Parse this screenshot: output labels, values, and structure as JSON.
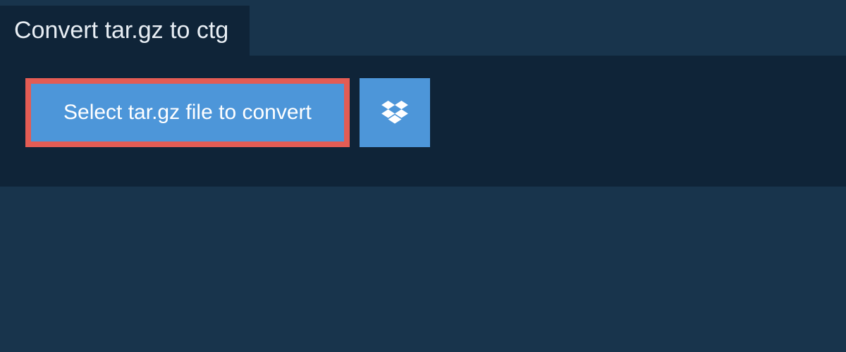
{
  "header": {
    "title": "Convert tar.gz to ctg"
  },
  "actions": {
    "select_file_label": "Select tar.gz file to convert"
  },
  "colors": {
    "page_bg": "#18344c",
    "panel_bg": "#0f2438",
    "button_bg": "#4d96d9",
    "button_border": "#e45c54",
    "text_light": "#ffffff"
  }
}
